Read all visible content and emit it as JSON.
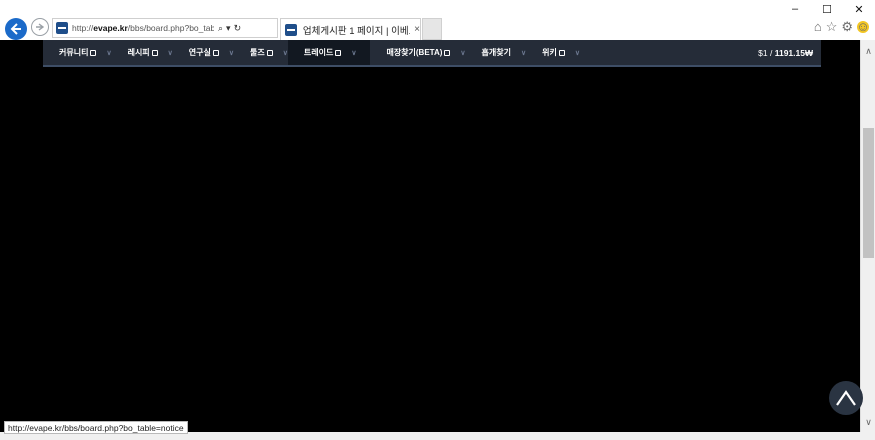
{
  "browser": {
    "address_url_domain": "evape.kr",
    "address_url_path": "/bbs/board.php?bo_table=sell",
    "address_url_prefix": "http://",
    "tab_title": "업체게시판 1 페이지 | 이베...",
    "search_glyph": "⌕",
    "dropdown_glyph": "▾",
    "refresh_glyph": "↻",
    "tab_close": "×",
    "minimize": "–",
    "maximize": "☐",
    "close": "✕",
    "home_glyph": "⌂",
    "star_glyph": "☆",
    "gear_glyph": "⚙",
    "smiley_glyph": "☺"
  },
  "site_nav": {
    "items": [
      {
        "label": "커뮤니티",
        "icon": "badge-icon"
      },
      {
        "label": "레시피",
        "icon": "badge-icon"
      },
      {
        "label": "연구실",
        "icon": "badge-icon"
      },
      {
        "label": "툴즈",
        "icon": "badge-icon"
      },
      {
        "label": "트레이드",
        "icon": "badge-icon"
      },
      {
        "label": "매장찾기(BETA)",
        "icon": "badge-icon"
      },
      {
        "label": "흡개찾기",
        "icon": null
      },
      {
        "label": "위키",
        "icon": "badge-icon"
      }
    ],
    "active_index": 4,
    "price_prefix": "$1 / ",
    "price_value": "1191.15₩"
  },
  "status_bar": {
    "url": "http://evape.kr/bbs/board.php?bo_table=notice"
  }
}
